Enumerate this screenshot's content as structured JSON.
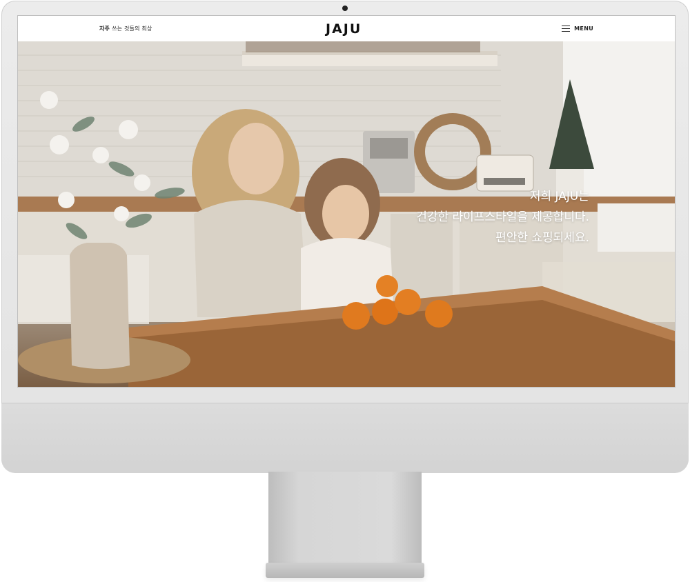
{
  "header": {
    "tagline_strong": "자주",
    "tagline_rest": "쓰는 것들의 최상",
    "logo": "JAJU",
    "menu_label": "MENU",
    "menu_icon": "hamburger-icon"
  },
  "hero": {
    "lines": [
      "저희 JAJU는",
      "건강한 라이프스타일을 제공합니다.",
      "편안한 쇼핑되세요."
    ]
  },
  "colors": {
    "hero_text": "#ffffff",
    "header_bg": "#ffffff",
    "monitor_body": "#e6e6e6",
    "table_wood": "#b07a4a",
    "orange": "#e0781e"
  }
}
